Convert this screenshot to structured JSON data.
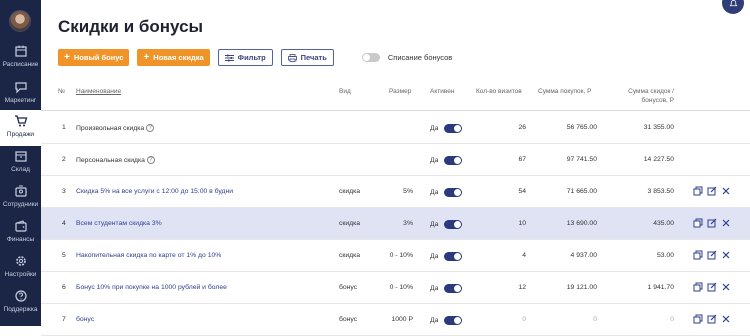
{
  "sidebar": {
    "items": [
      {
        "label": "Расписание",
        "icon": "calendar-icon"
      },
      {
        "label": "Маркетинг",
        "icon": "chat-icon"
      },
      {
        "label": "Продажи",
        "icon": "cart-icon",
        "active": true
      },
      {
        "label": "Склад",
        "icon": "box-icon"
      },
      {
        "label": "Сотрудники",
        "icon": "badge-icon"
      },
      {
        "label": "Финансы",
        "icon": "wallet-icon"
      },
      {
        "label": "Настройки",
        "icon": "gear-icon"
      },
      {
        "label": "Поддержка",
        "icon": "question-icon"
      }
    ]
  },
  "page": {
    "title": "Скидки и бонусы"
  },
  "toolbar": {
    "new_bonus": "Новый бонус",
    "new_discount": "Новая скидка",
    "filter": "Фильтр",
    "print": "Печать",
    "write_off_label": "Списание бонусов",
    "write_off_enabled": false
  },
  "table": {
    "headers": {
      "num": "№",
      "name": "Наименование",
      "kind": "Вид",
      "size": "Размер",
      "active": "Активен",
      "visits": "Кол-во визитов",
      "sum": "Сумма покупок, Р",
      "disc_1": "Сумма скидок /",
      "disc_2": "бонусов, Р"
    },
    "rows": [
      {
        "num": "1",
        "name": "Произвольная скидка",
        "help": "?",
        "kind": "",
        "size": "",
        "active": "Да",
        "visits": "26",
        "sum": "56 765.00",
        "disc": "31 355.00",
        "actions": false
      },
      {
        "num": "2",
        "name": "Персональная скидка",
        "help": "?",
        "kind": "",
        "size": "",
        "active": "Да",
        "visits": "67",
        "sum": "97 741.50",
        "disc": "14 227.50",
        "actions": false
      },
      {
        "num": "3",
        "name": "Скидка 5% на все услуги с 12:00 до 15:00 в будни",
        "help": "",
        "kind": "скидка",
        "size": "5%",
        "active": "Да",
        "visits": "54",
        "sum": "71 665.00",
        "disc": "3 853.50",
        "actions": true
      },
      {
        "num": "4",
        "name": "Всем студентам скидка 3%",
        "help": "",
        "kind": "скидка",
        "size": "3%",
        "active": "Да",
        "visits": "10",
        "sum": "13 690.00",
        "disc": "435.00",
        "actions": true,
        "highlight": true
      },
      {
        "num": "5",
        "name": "Накопительная скидка по карте от 1% до 10%",
        "help": "",
        "kind": "скидка",
        "size": "0 - 10%",
        "active": "Да",
        "visits": "4",
        "sum": "4 937.00",
        "disc": "53.00",
        "actions": true
      },
      {
        "num": "6",
        "name": "Бонус 10% при покупке на 1000 рублей и более",
        "help": "",
        "kind": "бонус",
        "size": "0 - 10%",
        "active": "Да",
        "visits": "12",
        "sum": "19 121.00",
        "disc": "1 941.70",
        "actions": true
      },
      {
        "num": "7",
        "name": "бонус",
        "help": "",
        "kind": "бонус",
        "size": "1000 Р",
        "active": "Да",
        "visits": "0",
        "sum": "0",
        "disc": "0",
        "actions": true,
        "muted": true
      }
    ]
  },
  "colors": {
    "sidebar": "#1b2646",
    "accent": "#f0942a",
    "link": "#2e3f8f",
    "highlight": "#dfe3f4"
  }
}
